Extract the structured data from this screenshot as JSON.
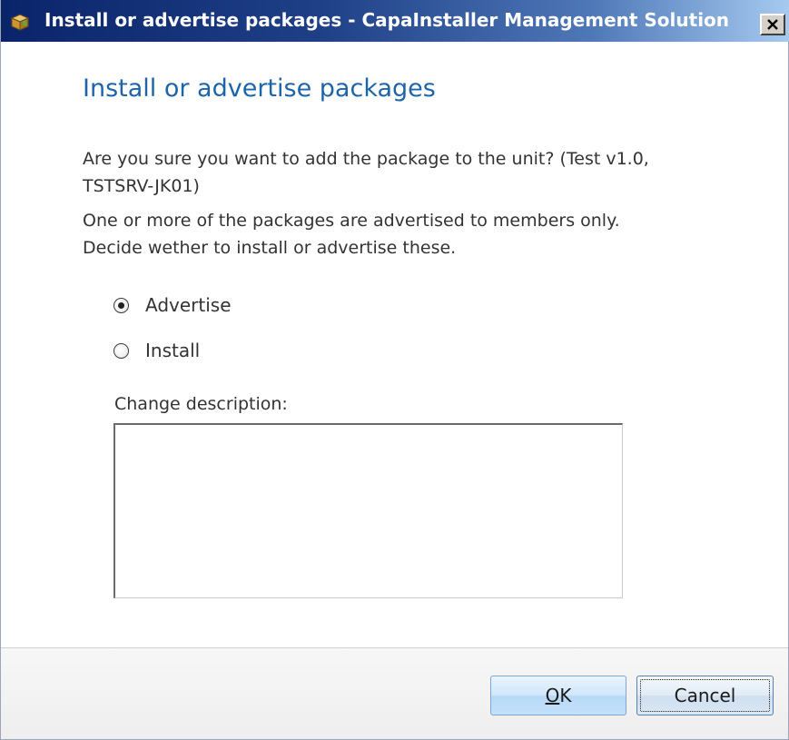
{
  "window": {
    "title": "Install or advertise packages - CapaInstaller Management Solution",
    "close_label": "✕"
  },
  "dialog": {
    "heading": "Install or advertise packages",
    "confirm_line1": "Are you sure you want to add the package to the unit? (Test v1.0,",
    "confirm_line2": "TSTSRV-JK01)",
    "info_line1": "One or more of the packages are advertised to members only.",
    "info_line2": "Decide wether to install or advertise these.",
    "options": [
      {
        "label": "Advertise",
        "selected": true
      },
      {
        "label": "Install",
        "selected": false
      }
    ],
    "change_description_label": "Change description:",
    "change_description_value": ""
  },
  "buttons": {
    "ok_accel": "O",
    "ok_rest": "K",
    "cancel_label": "Cancel"
  },
  "colors": {
    "heading": "#1e64a8",
    "titlebar_start": "#0a246a",
    "titlebar_end": "#a6caf0"
  },
  "icons": {
    "app": "package-box-icon",
    "close": "close-icon"
  }
}
